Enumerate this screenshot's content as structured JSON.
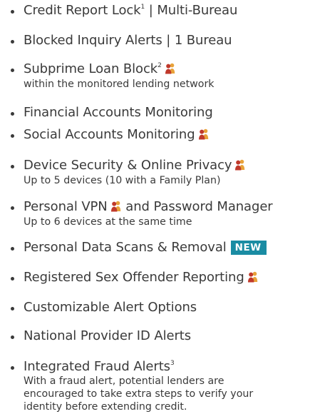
{
  "features": [
    {
      "label": "Credit Report Lock",
      "sup": "1",
      "suffix": " | Multi-Bureau"
    },
    {
      "label": "Blocked Inquiry Alerts | 1 Bureau"
    },
    {
      "label": "Subprime Loan Block",
      "sup": "2",
      "sub": "within the monitored lending network"
    },
    {
      "label": "Financial Accounts Monitoring"
    },
    {
      "label": "Social Accounts Monitoring"
    },
    {
      "label": "Device Security & Online Privacy",
      "sub": "Up to 5 devices (10 with a Family Plan)"
    },
    {
      "label": "Personal VPN",
      "suffix": " and Password Manager",
      "sub": "Up to 6 devices at the same time"
    },
    {
      "label": "Personal Data Scans & Removal",
      "badge": "NEW"
    },
    {
      "label": "Registered Sex Offender Reporting"
    },
    {
      "label": "Customizable Alert Options"
    },
    {
      "label": "National Provider ID Alerts"
    },
    {
      "label": "Integrated Fraud Alerts",
      "sup": "3",
      "sub1": "With a fraud alert, potential lenders are",
      "sub2": "encouraged to take extra steps to verify your",
      "sub3": "identity before extending credit."
    }
  ],
  "colors": {
    "text": "#3a3a3a",
    "icon": "#c0392b",
    "badge": "#1a8ca3"
  },
  "icons": {
    "family": "family-person-icon"
  }
}
